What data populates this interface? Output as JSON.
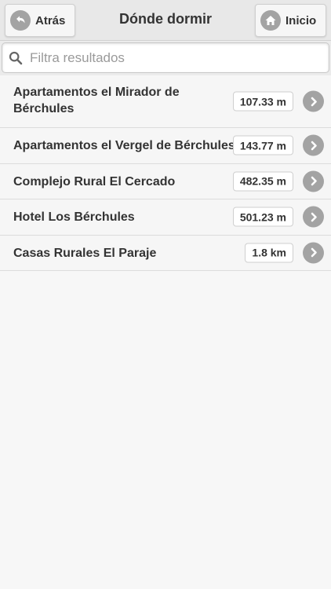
{
  "header": {
    "back_label": "Atrás",
    "title": "Dónde dormir",
    "home_label": "Inicio",
    "back_icon": "back-arrow-icon",
    "home_icon": "home-icon"
  },
  "search": {
    "placeholder": "Filtra resultados",
    "value": "",
    "icon": "search-icon"
  },
  "results": [
    {
      "name": "Apartamentos el Mirador de Bérchules",
      "distance": "107.33 m"
    },
    {
      "name": "Apartamentos el Vergel de Bérchules",
      "distance": "143.77 m"
    },
    {
      "name": "Complejo Rural El Cercado",
      "distance": "482.35 m"
    },
    {
      "name": "Hotel Los Bérchules",
      "distance": "501.23 m"
    },
    {
      "name": "Casas Rurales El Paraje",
      "distance": "1.8 km"
    }
  ],
  "colors": {
    "header_bg": "#e8e8e8",
    "icon_disc": "#a3a3a3",
    "page_bg": "#f7f7f7"
  }
}
